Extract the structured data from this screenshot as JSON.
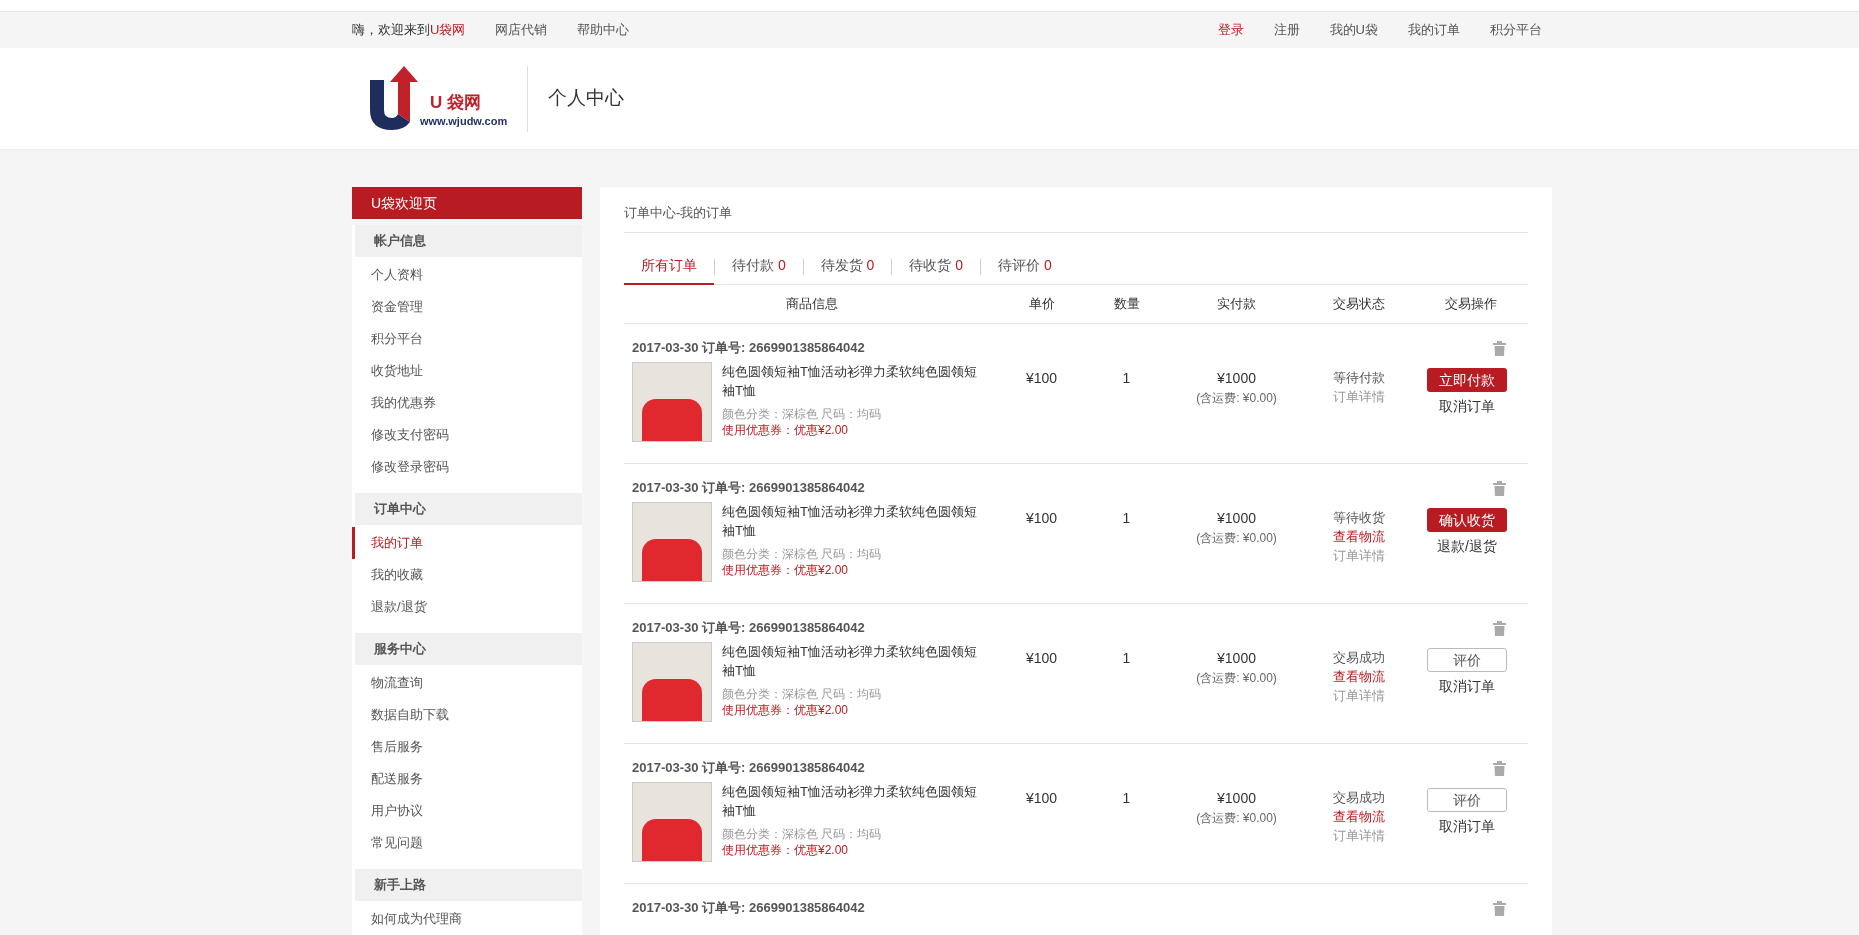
{
  "top_bar": {
    "welcome": "嗨，欢迎来到",
    "site_name": "U袋网",
    "left_links": [
      "网店代销",
      "帮助中心"
    ],
    "right_links": [
      {
        "label": "登录",
        "highlight": true
      },
      {
        "label": "注册",
        "highlight": false
      },
      {
        "label": "我的U袋",
        "highlight": false
      },
      {
        "label": "我的订单",
        "highlight": false
      },
      {
        "label": "积分平台",
        "highlight": false
      }
    ]
  },
  "header": {
    "logo_text": "U 袋网",
    "logo_url": "www.wjudw.com",
    "page_title": "个人中心"
  },
  "sidebar": {
    "welcome": "U袋欢迎页",
    "groups": [
      {
        "title": "帐户信息",
        "items": [
          {
            "label": "个人资料",
            "selected": false
          },
          {
            "label": "资金管理",
            "selected": false
          },
          {
            "label": "积分平台",
            "selected": false
          },
          {
            "label": "收货地址",
            "selected": false
          },
          {
            "label": "我的优惠券",
            "selected": false
          },
          {
            "label": "修改支付密码",
            "selected": false
          },
          {
            "label": "修改登录密码",
            "selected": false
          }
        ]
      },
      {
        "title": "订单中心",
        "items": [
          {
            "label": "我的订单",
            "selected": true
          },
          {
            "label": "我的收藏",
            "selected": false
          },
          {
            "label": "退款/退货",
            "selected": false
          }
        ]
      },
      {
        "title": "服务中心",
        "items": [
          {
            "label": "物流查询",
            "selected": false
          },
          {
            "label": "数据自助下载",
            "selected": false
          },
          {
            "label": "售后服务",
            "selected": false
          },
          {
            "label": "配送服务",
            "selected": false
          },
          {
            "label": "用户协议",
            "selected": false
          },
          {
            "label": "常见问题",
            "selected": false
          }
        ]
      },
      {
        "title": "新手上路",
        "items": [
          {
            "label": "如何成为代理商",
            "selected": false
          }
        ]
      }
    ]
  },
  "main": {
    "breadcrumb": "订单中心-我的订单",
    "tabs": [
      {
        "label": "所有订单",
        "selected": true
      },
      {
        "label": "待付款",
        "count": "0",
        "selected": false
      },
      {
        "label": "待发货",
        "count": "0",
        "selected": false
      },
      {
        "label": "待收货",
        "count": "0",
        "selected": false
      },
      {
        "label": "待评价",
        "count": "0",
        "selected": false
      }
    ],
    "columns": [
      "商品信息",
      "单价",
      "数量",
      "实付款",
      "交易状态",
      "交易操作"
    ],
    "orders": [
      {
        "header": "2017-03-30 订单号: 2669901385864042",
        "title": "纯色圆领短袖T恤活动衫弹力柔软纯色圆领短袖T恤",
        "spec": "颜色分类：深棕色 尺码：均码",
        "coupon": "使用优惠券：优惠¥2.00",
        "price": "¥100",
        "qty": "1",
        "total": "¥1000",
        "shipping": "(含运费: ¥0.00)",
        "status": [
          {
            "label": "等待付款",
            "kind": "text"
          },
          {
            "label": "订单详情",
            "kind": "link"
          }
        ],
        "actions": [
          {
            "label": "立即付款",
            "kind": "primary"
          },
          {
            "label": "取消订单",
            "kind": "text"
          }
        ]
      },
      {
        "header": "2017-03-30 订单号: 2669901385864042",
        "title": "纯色圆领短袖T恤活动衫弹力柔软纯色圆领短袖T恤",
        "spec": "颜色分类：深棕色 尺码：均码",
        "coupon": "使用优惠券：优惠¥2.00",
        "price": "¥100",
        "qty": "1",
        "total": "¥1000",
        "shipping": "(含运费: ¥0.00)",
        "status": [
          {
            "label": "等待收货",
            "kind": "text"
          },
          {
            "label": "查看物流",
            "kind": "accent"
          },
          {
            "label": "订单详情",
            "kind": "link"
          }
        ],
        "actions": [
          {
            "label": "确认收货",
            "kind": "primary"
          },
          {
            "label": "退款/退货",
            "kind": "text"
          }
        ]
      },
      {
        "header": "2017-03-30 订单号: 2669901385864042",
        "title": "纯色圆领短袖T恤活动衫弹力柔软纯色圆领短袖T恤",
        "spec": "颜色分类：深棕色 尺码：均码",
        "coupon": "使用优惠券：优惠¥2.00",
        "price": "¥100",
        "qty": "1",
        "total": "¥1000",
        "shipping": "(含运费: ¥0.00)",
        "status": [
          {
            "label": "交易成功",
            "kind": "text"
          },
          {
            "label": "查看物流",
            "kind": "accent"
          },
          {
            "label": "订单详情",
            "kind": "link"
          }
        ],
        "actions": [
          {
            "label": "评价",
            "kind": "outline"
          },
          {
            "label": "取消订单",
            "kind": "text"
          }
        ]
      },
      {
        "header": "2017-03-30 订单号: 2669901385864042",
        "title": "纯色圆领短袖T恤活动衫弹力柔软纯色圆领短袖T恤",
        "spec": "颜色分类：深棕色 尺码：均码",
        "coupon": "使用优惠券：优惠¥2.00",
        "price": "¥100",
        "qty": "1",
        "total": "¥1000",
        "shipping": "(含运费: ¥0.00)",
        "status": [
          {
            "label": "交易成功",
            "kind": "text"
          },
          {
            "label": "查看物流",
            "kind": "accent"
          },
          {
            "label": "订单详情",
            "kind": "link"
          }
        ],
        "actions": [
          {
            "label": "评价",
            "kind": "outline"
          },
          {
            "label": "取消订单",
            "kind": "text"
          }
        ]
      },
      {
        "header": "2017-03-30 订单号: 2669901385864042"
      }
    ]
  }
}
